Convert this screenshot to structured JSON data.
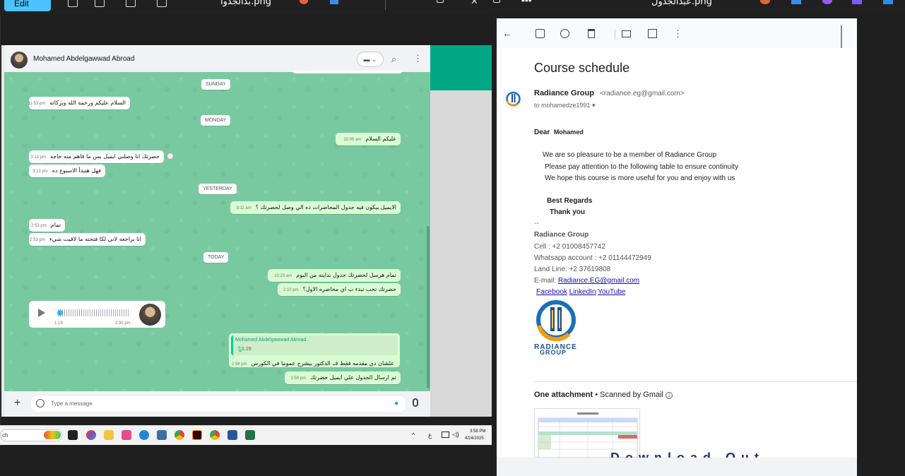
{
  "top": {
    "edit_label": "Edit",
    "title_left": "بدالجدوا.png",
    "title_right": "عبدالجدول.png"
  },
  "whatsapp": {
    "contact_name": "Mohamed Abdelgawwad Abroad",
    "search_icon": "search-icon",
    "days": [
      "SUNDAY",
      "MONDAY",
      "YESTERDAY",
      "TODAY"
    ],
    "messages": [
      {
        "text": "السلام عليكم ورحمة الله وبركاته",
        "time": "11:53 pm"
      },
      {
        "text": "عليكم السلام",
        "time": "10:06 am"
      },
      {
        "text": "حضرتك انا وصلني ايميل بس ما فاهم منه حاجه",
        "time": "3:13 pm"
      },
      {
        "text": "فهل هنبدأ الاسبوع ده",
        "time": "3:13 pm"
      },
      {
        "text": "الايميل بيكون فيه جدول المحاضرات ده الي وصل لحضرتك ؟",
        "time": "9:11 am"
      },
      {
        "text": "تمام",
        "time": "2:53 pm"
      },
      {
        "text": "انا براجعه  لاني لكا فتحته ما لاقيت شيء",
        "time": "2:53 pm"
      },
      {
        "text": "تمام هرسل لحضرتك جدول بدايته من اليوم",
        "time": "10:23 am"
      },
      {
        "text": "حضرتك تحب تبدء ب اي محاضره الاول؟",
        "time": "2:10 pm"
      },
      {
        "text": "علشان دي مقدمه فقط ف الدكتور بيشرح عموما في الكورس",
        "time": "2:58 pm"
      },
      {
        "text": "تم ارسال الجدول علي ايميل حضرتك",
        "time": "3:58 pm"
      }
    ],
    "voice": {
      "duration": "1:19",
      "time": "2:30 pm"
    },
    "quote": {
      "name": "Mohamed Abdelgawwad Abroad",
      "duration": "1:19"
    },
    "input_placeholder": "Type a message"
  },
  "taskbar": {
    "search_text": "ch",
    "time": "3:58 PM",
    "date": "4/24/2025",
    "lang": "ع"
  },
  "email": {
    "subject": "Course schedule",
    "sender_name": "Radiance Group",
    "sender_email": "<radiance.eg@gmail.com>",
    "to": "to mohamedze1991",
    "greeting": "Dear",
    "greeting_name": "Mohamed",
    "lines": [
      "We are so pleasure to be a member of Radiance Group",
      "Please pay attention to the following table to ensure continuity",
      "We hope this course is more useful for you and enjoy with us"
    ],
    "regards": "Best Regards",
    "thanks": "Thank you",
    "sep": "--",
    "sig_name": "Radiance Group",
    "cell": "Cell : +2 01008457742",
    "whatsapp": "Whatsapp account : +2 01144472949",
    "landline": "Land Line: +2 37619808",
    "email_label": "E-mail: ",
    "email_link": "Radiance.EG@gmail.com",
    "links": [
      "Facebook",
      "LinkedIn",
      "YouTube"
    ],
    "logo_line1": "RADIANCE",
    "logo_line2": "GROUP",
    "attachment_title": "One attachment",
    "scanned": " • Scanned by Gmail",
    "download_text": "Download Out"
  },
  "colors": {
    "wa_green": "#00a884",
    "wa_bg": "#79c9a0",
    "bubble_out": "#d9fdd3",
    "edit_blue": "#4cc2ff",
    "link": "#1a0dab"
  }
}
